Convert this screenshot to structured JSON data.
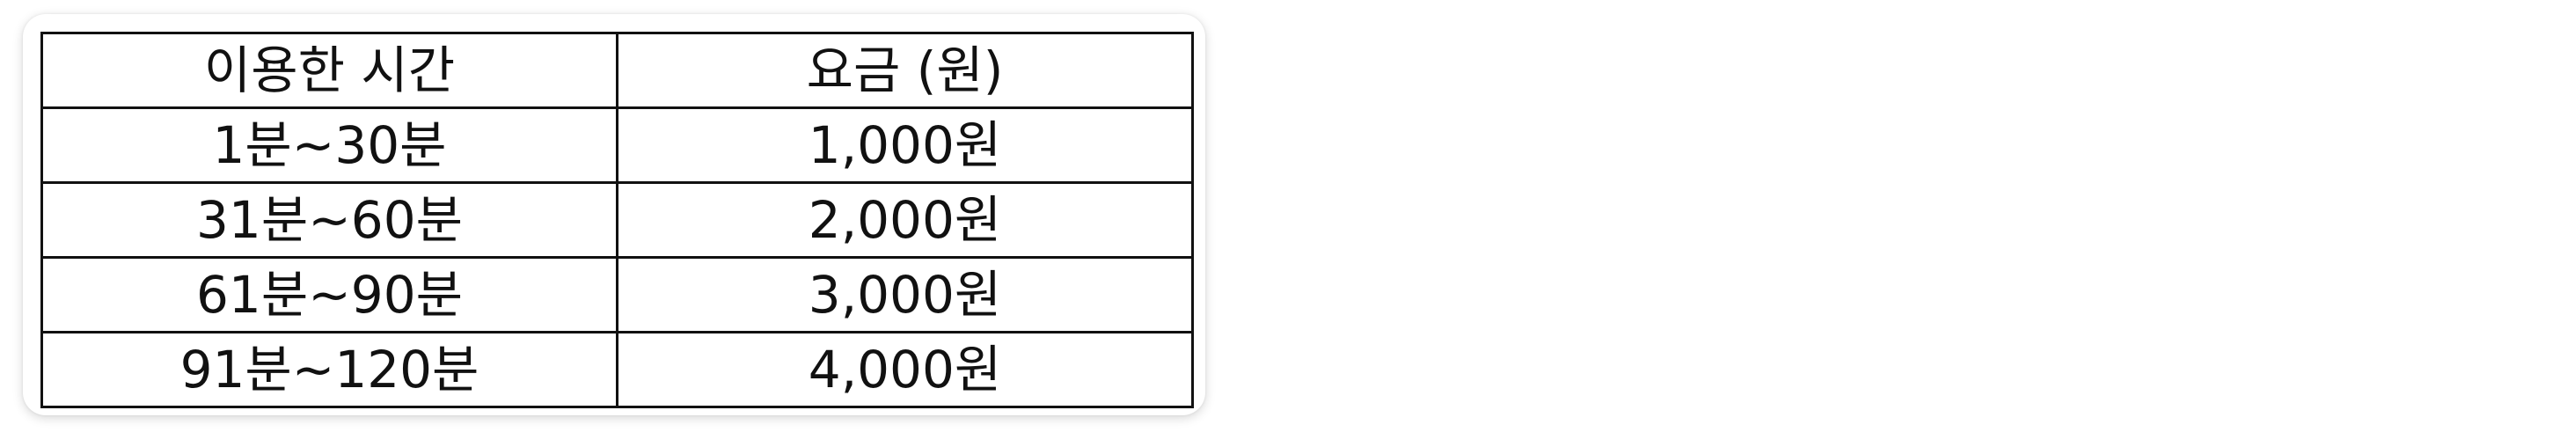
{
  "table": {
    "headers": [
      "이용한 시간",
      "요금 (원)"
    ],
    "rows": [
      [
        "1분~30분",
        "1,000원"
      ],
      [
        "31분~60분",
        "2,000원"
      ],
      [
        "61분~90분",
        "3,000원"
      ],
      [
        "91분~120분",
        "4,000원"
      ]
    ]
  },
  "colors": {
    "border": "#111111",
    "text": "#111111",
    "background": "#ffffff"
  }
}
